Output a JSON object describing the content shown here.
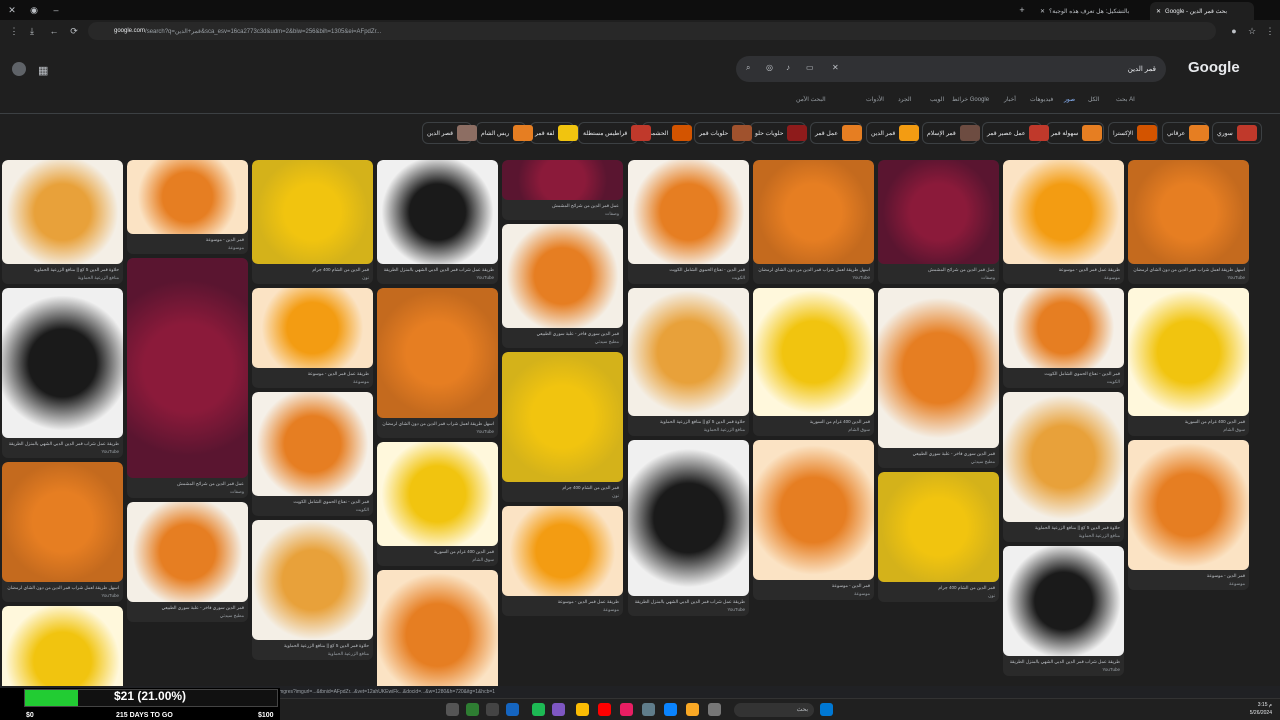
{
  "browser": {
    "tabs": [
      {
        "label": "Google - بحث قمر الدين",
        "active": true
      },
      {
        "label": "بالتشكيل: هل تعرف هذه الوجبة؟",
        "active": false
      }
    ],
    "url_domain": "google.com",
    "url_rest": "/search?q=قمر+الدين&sca_esv=16ca2773c3d&udm=2&biw=256&bih=1305&ei=AFpdZr..."
  },
  "google": {
    "logo": "Google",
    "query": "قمر الدين",
    "tabs": [
      "بحث AI",
      "الكل",
      "صور",
      "فيديوهات",
      "أخبار",
      "خرائط Google",
      "الويب",
      "الجرد",
      "الأدوات"
    ],
    "active_tab": "صور",
    "safe_search": "البحث الآمن"
  },
  "chips": [
    {
      "label": "سوري",
      "color": "#c0392b"
    },
    {
      "label": "عرقاني",
      "color": "#e67e22"
    },
    {
      "label": "الإكسترا",
      "color": "#d35400"
    },
    {
      "label": "سهولة قمر",
      "color": "#e67e22"
    },
    {
      "label": "عمل عصير قمر",
      "color": "#c0392b"
    },
    {
      "label": "قمر الإسلام",
      "color": "#6d4c41"
    },
    {
      "label": "قمر الدين",
      "color": "#f39c12"
    },
    {
      "label": "عمل قمر",
      "color": "#e67e22"
    },
    {
      "label": "حلويات حلو",
      "color": "#8e1b1b"
    },
    {
      "label": "حلويات قمر",
      "color": "#a0522d"
    },
    {
      "label": "الحشمي",
      "color": "#d35400"
    },
    {
      "label": "قراطيس مستطلة",
      "color": "#c0392b"
    },
    {
      "label": "لفة قمر",
      "color": "#f1c40f"
    },
    {
      "label": "ريس الشام",
      "color": "#e67e22"
    },
    {
      "label": "قصر الدين",
      "color": "#8d6e63"
    }
  ],
  "cards": [
    {
      "cap": "حلاوة قمر الدين 5 كغ || منافع الزرعية الحماوية",
      "src": "منافع الزرعية الحماوية",
      "color": "#e8a13a",
      "bg": "#f4efe6"
    },
    {
      "cap": "طريقة عمل شراب قمر الدين الدبي الشهي بالمنزل الطريقة",
      "src": "YouTube",
      "color": "#1a1a1a",
      "bg": "#f0f0f0"
    },
    {
      "cap": "أسهل طريقة لعمل شراب قمر الدين من دون الشاي لرمضان",
      "src": "YouTube",
      "color": "#e67e22",
      "bg": "#c46a1e"
    },
    {
      "cap": "قمر الدين 400 غرام من السورية",
      "src": "سوق الشام",
      "color": "#f1c40f",
      "bg": "#fff8dc"
    },
    {
      "cap": "قمر الدين - موسوعة",
      "src": "موسوعة",
      "color": "#e67e22",
      "bg": "#fbe3c4"
    },
    {
      "cap": "عمل قمر الدين من شرائح المشمش",
      "src": "وصفات",
      "color": "#8b1a3a",
      "bg": "#5a1530"
    },
    {
      "cap": "قمر الدين سوري فاخر - علبة سوري الطبيعي",
      "src": "مطبخ سيدتي",
      "color": "#e67e22",
      "bg": "#f4efe6"
    },
    {
      "cap": "قمر الدين من الشام 400 جرام",
      "src": "نون",
      "color": "#f1c40f",
      "bg": "#d4b21a"
    },
    {
      "cap": "طريقة عمل قمر الدين - موسوعة",
      "src": "موسوعة",
      "color": "#f39c12",
      "bg": "#fbe3c4"
    },
    {
      "cap": "قمر الدين - نعناع الحموي الشامل الكويت",
      "src": "الكويت",
      "color": "#e67e22",
      "bg": "#f5f0e8"
    }
  ],
  "statusbar_url": "imgres?imgurl=...&tbnid=AFpdZr...&vet=12ahUKEwiFk...&docid=...&w=1280&h=720&itg=1&hcb=1",
  "overlay": {
    "amount": "$21 (21.00%)",
    "progress": 0.21,
    "low": "$0",
    "high": "$100",
    "days": "215 DAYS TO GO"
  },
  "taskbar": {
    "search_label": "بحث",
    "time": "3:15 م",
    "date": "5/26/2024"
  }
}
